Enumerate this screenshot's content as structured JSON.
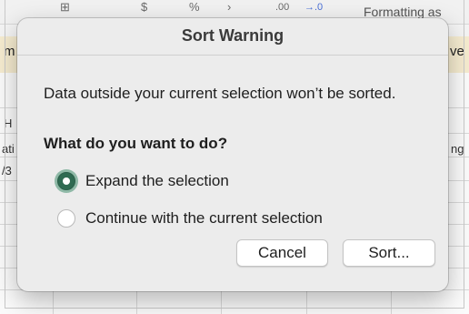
{
  "background": {
    "ribbon": {
      "glyphs": [
        "⊞",
        "$",
        "%",
        "›",
        ".00",
        "→.0"
      ],
      "formatting_text": "Formatting as"
    },
    "banner": {
      "left_fragment": "m",
      "right_fragment": "ve"
    },
    "grid": {
      "column_fragment": "H",
      "row_fragments_left": [
        "ati",
        "/3"
      ],
      "row_fragment_right": "ng"
    }
  },
  "dialog": {
    "title": "Sort Warning",
    "message": "Data outside your current selection won’t be sorted.",
    "question": "What do you want to do?",
    "options": [
      {
        "label": "Expand the selection",
        "selected": true
      },
      {
        "label": "Continue with the current selection",
        "selected": false
      }
    ],
    "buttons": {
      "cancel": "Cancel",
      "sort": "Sort..."
    },
    "accent_color": "#2f6b52"
  }
}
